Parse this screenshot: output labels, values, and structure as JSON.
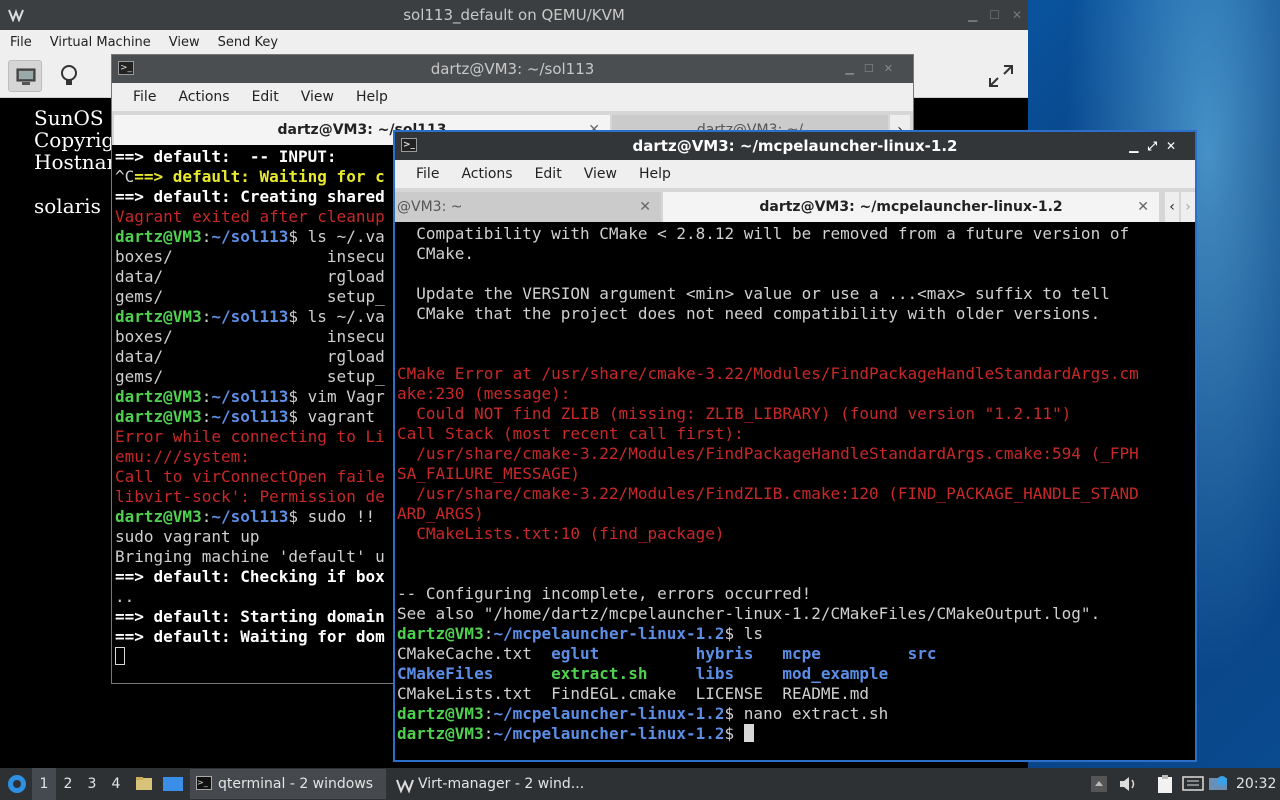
{
  "qemu": {
    "title": "sol113_default on QEMU/KVM",
    "menu": [
      "File",
      "Virtual Machine",
      "View",
      "Send Key"
    ],
    "console_lines": [
      "SunOS R",
      "Copyrig",
      "Hostnam",
      "",
      "solaris"
    ]
  },
  "term_back": {
    "title": "dartz@VM3: ~/sol113",
    "menu": [
      "File",
      "Actions",
      "Edit",
      "View",
      "Help"
    ],
    "tab_active": "dartz@VM3: ~/sol113",
    "tab_second": "dartz@VM3: ~/",
    "lines": [
      {
        "segs": [
          [
            "w",
            "==> default:  -- INPUT:"
          ]
        ]
      },
      {
        "segs": [
          [
            "c",
            "^C"
          ],
          [
            "y",
            "==> default: Waiting for c"
          ]
        ]
      },
      {
        "segs": [
          [
            "w",
            "==> default: Creating shared"
          ]
        ]
      },
      {
        "segs": [
          [
            "r",
            "Vagrant exited after cleanup"
          ]
        ]
      },
      {
        "segs": [
          [
            "g",
            "dartz@VM3"
          ],
          [
            "c",
            ":"
          ],
          [
            "b",
            "~/sol113"
          ],
          [
            "c",
            "$ ls ~/.va"
          ]
        ]
      },
      {
        "segs": [
          [
            "c",
            "boxes/                insecu"
          ]
        ]
      },
      {
        "segs": [
          [
            "c",
            "data/                 rgload"
          ]
        ]
      },
      {
        "segs": [
          [
            "c",
            "gems/                 setup_"
          ]
        ]
      },
      {
        "segs": [
          [
            "g",
            "dartz@VM3"
          ],
          [
            "c",
            ":"
          ],
          [
            "b",
            "~/sol113"
          ],
          [
            "c",
            "$ ls ~/.va"
          ]
        ]
      },
      {
        "segs": [
          [
            "c",
            "boxes/                insecu"
          ]
        ]
      },
      {
        "segs": [
          [
            "c",
            "data/                 rgload"
          ]
        ]
      },
      {
        "segs": [
          [
            "c",
            "gems/                 setup_"
          ]
        ]
      },
      {
        "segs": [
          [
            "g",
            "dartz@VM3"
          ],
          [
            "c",
            ":"
          ],
          [
            "b",
            "~/sol113"
          ],
          [
            "c",
            "$ vim Vagr"
          ]
        ]
      },
      {
        "segs": [
          [
            "g",
            "dartz@VM3"
          ],
          [
            "c",
            ":"
          ],
          [
            "b",
            "~/sol113"
          ],
          [
            "c",
            "$ vagrant "
          ]
        ]
      },
      {
        "segs": [
          [
            "r",
            "Error while connecting to Li"
          ]
        ]
      },
      {
        "segs": [
          [
            "r",
            "emu:///system:"
          ]
        ]
      },
      {
        "segs": [
          [
            "r",
            "Call to virConnectOpen faile"
          ]
        ]
      },
      {
        "segs": [
          [
            "r",
            "libvirt-sock': Permission de"
          ]
        ]
      },
      {
        "segs": [
          [
            "g",
            "dartz@VM3"
          ],
          [
            "c",
            ":"
          ],
          [
            "b",
            "~/sol113"
          ],
          [
            "c",
            "$ sudo !! "
          ]
        ]
      },
      {
        "segs": [
          [
            "c",
            "sudo vagrant up"
          ]
        ]
      },
      {
        "segs": [
          [
            "c",
            "Bringing machine 'default' u"
          ]
        ]
      },
      {
        "segs": [
          [
            "w",
            "==> default: Checking if box"
          ]
        ]
      },
      {
        "segs": [
          [
            "c",
            ".."
          ]
        ]
      },
      {
        "segs": [
          [
            "w",
            "==> default: Starting domain"
          ]
        ]
      },
      {
        "segs": [
          [
            "w",
            "==> default: Waiting for dom"
          ]
        ]
      }
    ]
  },
  "term_front": {
    "title": "dartz@VM3: ~/mcpelauncher-linux-1.2",
    "menu": [
      "File",
      "Actions",
      "Edit",
      "View",
      "Help"
    ],
    "tab_first": "@VM3: ~",
    "tab_active": "dartz@VM3: ~/mcpelauncher-linux-1.2",
    "lines": [
      {
        "segs": [
          [
            "c",
            "  Compatibility with CMake < 2.8.12 will be removed from a future version of"
          ]
        ]
      },
      {
        "segs": [
          [
            "c",
            "  CMake."
          ]
        ]
      },
      {
        "segs": [
          [
            "c",
            ""
          ]
        ]
      },
      {
        "segs": [
          [
            "c",
            "  Update the VERSION argument <min> value or use a ...<max> suffix to tell"
          ]
        ]
      },
      {
        "segs": [
          [
            "c",
            "  CMake that the project does not need compatibility with older versions."
          ]
        ]
      },
      {
        "segs": [
          [
            "c",
            ""
          ]
        ]
      },
      {
        "segs": [
          [
            "c",
            ""
          ]
        ]
      },
      {
        "segs": [
          [
            "r",
            "CMake Error at /usr/share/cmake-3.22/Modules/FindPackageHandleStandardArgs.cm"
          ]
        ]
      },
      {
        "segs": [
          [
            "r",
            "ake:230 (message):"
          ]
        ]
      },
      {
        "segs": [
          [
            "r",
            "  Could NOT find ZLIB (missing: ZLIB_LIBRARY) (found version \"1.2.11\")"
          ]
        ]
      },
      {
        "segs": [
          [
            "r",
            "Call Stack (most recent call first):"
          ]
        ]
      },
      {
        "segs": [
          [
            "r",
            "  /usr/share/cmake-3.22/Modules/FindPackageHandleStandardArgs.cmake:594 (_FPH"
          ]
        ]
      },
      {
        "segs": [
          [
            "r",
            "SA_FAILURE_MESSAGE)"
          ]
        ]
      },
      {
        "segs": [
          [
            "r",
            "  /usr/share/cmake-3.22/Modules/FindZLIB.cmake:120 (FIND_PACKAGE_HANDLE_STAND"
          ]
        ]
      },
      {
        "segs": [
          [
            "r",
            "ARD_ARGS)"
          ]
        ]
      },
      {
        "segs": [
          [
            "r",
            "  CMakeLists.txt:10 (find_package)"
          ]
        ]
      },
      {
        "segs": [
          [
            "c",
            ""
          ]
        ]
      },
      {
        "segs": [
          [
            "c",
            ""
          ]
        ]
      },
      {
        "segs": [
          [
            "c",
            "-- Configuring incomplete, errors occurred!"
          ]
        ]
      },
      {
        "segs": [
          [
            "c",
            "See also \"/home/dartz/mcpelauncher-linux-1.2/CMakeFiles/CMakeOutput.log\"."
          ]
        ]
      },
      {
        "segs": [
          [
            "g",
            "dartz@VM3"
          ],
          [
            "c",
            ":"
          ],
          [
            "b",
            "~/mcpelauncher-linux-1.2"
          ],
          [
            "c",
            "$ ls"
          ]
        ]
      },
      {
        "segs": [
          [
            "c",
            "CMakeCache.txt  "
          ],
          [
            "b",
            "eglut"
          ],
          [
            "c",
            "          "
          ],
          [
            "b",
            "hybris"
          ],
          [
            "c",
            "   "
          ],
          [
            "b",
            "mcpe"
          ],
          [
            "c",
            "         "
          ],
          [
            "b",
            "src"
          ]
        ]
      },
      {
        "segs": [
          [
            "b",
            "CMakeFiles"
          ],
          [
            "c",
            "      "
          ],
          [
            "g",
            "extract.sh"
          ],
          [
            "c",
            "     "
          ],
          [
            "b",
            "libs"
          ],
          [
            "c",
            "     "
          ],
          [
            "b",
            "mod_example"
          ]
        ]
      },
      {
        "segs": [
          [
            "c",
            "CMakeLists.txt  FindEGL.cmake  LICENSE  README.md"
          ]
        ]
      },
      {
        "segs": [
          [
            "g",
            "dartz@VM3"
          ],
          [
            "c",
            ":"
          ],
          [
            "b",
            "~/mcpelauncher-linux-1.2"
          ],
          [
            "c",
            "$ nano extract.sh"
          ]
        ]
      },
      {
        "segs": [
          [
            "g",
            "dartz@VM3"
          ],
          [
            "c",
            ":"
          ],
          [
            "b",
            "~/mcpelauncher-linux-1.2"
          ],
          [
            "c",
            "$ "
          ]
        ],
        "cursor": true
      }
    ]
  },
  "taskbar": {
    "workspaces": [
      "1",
      "2",
      "3",
      "4"
    ],
    "tasks": [
      "qterminal - 2 windows",
      "Virt-manager - 2 wind..."
    ],
    "clock": "20:32"
  },
  "colors": {
    "front_border": "#2b6fc9",
    "prompt_green": "#4fd14f",
    "path_blue": "#5c8ee6",
    "error_red": "#c82828"
  }
}
